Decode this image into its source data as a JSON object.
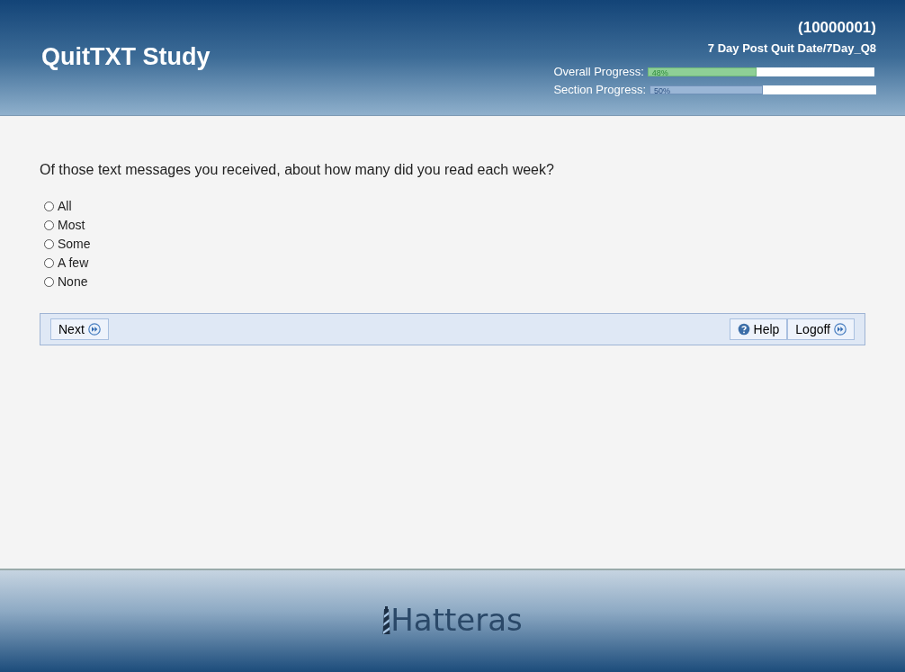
{
  "header": {
    "title": "QuitTXT Study",
    "participant_id": "(10000001)",
    "section": "7 Day Post Quit Date/7Day_Q8",
    "progress": [
      {
        "label": "Overall Progress:",
        "reading": "48%",
        "level": 0.48,
        "kind": "overall"
      },
      {
        "label": "Section Progress:",
        "reading": "50%",
        "level": 0.5,
        "kind": "section"
      }
    ]
  },
  "question": "Of those text messages you received, about how many did you read each week?",
  "options": [
    {
      "label": "All",
      "selected": false
    },
    {
      "label": "Most",
      "selected": false
    },
    {
      "label": "Some",
      "selected": false
    },
    {
      "label": "A few",
      "selected": false
    },
    {
      "label": "None",
      "selected": false
    }
  ],
  "toolbar": {
    "left": [
      {
        "label": "Next",
        "kind": "forward"
      }
    ],
    "right": [
      {
        "label": "Help",
        "kind": "help"
      },
      {
        "label": "Logoff",
        "kind": "forward"
      }
    ]
  },
  "footer": {
    "logo": "Hatteras"
  }
}
